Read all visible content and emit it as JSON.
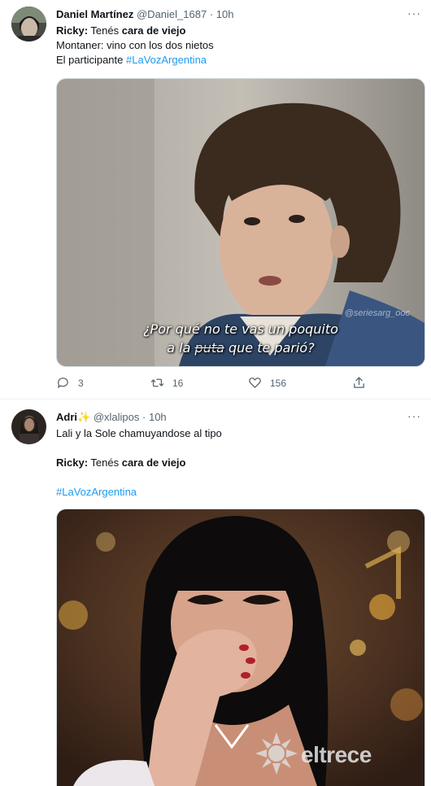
{
  "tweet1": {
    "display_name": "Daniel Martínez",
    "handle": "@Daniel_1687",
    "separator": "·",
    "time": "10h",
    "more": "···",
    "line1_prefix": "Ricky:",
    "line1_mid": " Tenés ",
    "line1_bold": "cara de viejo",
    "line2": "Montaner: vino con los dos nietos",
    "line3_prefix": "El participante ",
    "hashtag": "#LaVozArgentina",
    "media": {
      "watermark": "@seriesarg_ooc",
      "subtitle_line1": "¿Por qué no te vas un poquito",
      "subtitle_line2_a": "a la ",
      "subtitle_line2_b": "puta",
      "subtitle_line2_c": " que te parió?"
    },
    "replies": "3",
    "retweets": "16",
    "likes": "156"
  },
  "tweet2": {
    "display_name": "Adri",
    "sparkle": "✨",
    "handle": "@xlalipos",
    "separator": "·",
    "time": "10h",
    "more": "···",
    "line1": "Lali y la Sole chamuyandose al tipo",
    "line2_prefix": "Ricky:",
    "line2_mid": " Tenés ",
    "line2_bold": "cara de viejo",
    "hashtag": "#LaVozArgentina",
    "media": {
      "logo_text": "eltrece"
    }
  },
  "colors": {
    "accent": "#1d9bf0",
    "muted": "#536471",
    "text": "#0f1419"
  }
}
